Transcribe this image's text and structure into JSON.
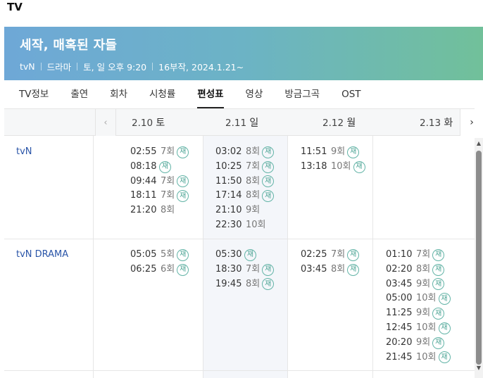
{
  "page": {
    "heading": "TV"
  },
  "program": {
    "title": "세작, 매혹된 자들",
    "meta": [
      "tvN",
      "드라마",
      "토, 일 오후 9:20",
      "16부작, 2024.1.21~"
    ]
  },
  "tabs": [
    {
      "label": "TV정보",
      "active": false
    },
    {
      "label": "출연",
      "active": false
    },
    {
      "label": "회차",
      "active": false
    },
    {
      "label": "시청률",
      "active": false
    },
    {
      "label": "편성표",
      "active": true
    },
    {
      "label": "영상",
      "active": false
    },
    {
      "label": "방금그곡",
      "active": false
    },
    {
      "label": "OST",
      "active": false
    }
  ],
  "schedule": {
    "prev_icon": "chevron-left-icon",
    "next_icon": "chevron-right-icon",
    "rerun_label": "재",
    "dates": [
      {
        "date": "2.10",
        "day": "토"
      },
      {
        "date": "2.11",
        "day": "일"
      },
      {
        "date": "2.12",
        "day": "월"
      },
      {
        "date": "2.13",
        "day": "화"
      }
    ],
    "channels": [
      {
        "name": "tvN",
        "days": [
          [
            {
              "time": "02:55",
              "ep": "7회",
              "rerun": true
            },
            {
              "time": "08:18",
              "ep": "",
              "rerun": true
            },
            {
              "time": "09:44",
              "ep": "7회",
              "rerun": true
            },
            {
              "time": "18:11",
              "ep": "7회",
              "rerun": true
            },
            {
              "time": "21:20",
              "ep": "8회",
              "rerun": false
            }
          ],
          [
            {
              "time": "03:02",
              "ep": "8회",
              "rerun": true
            },
            {
              "time": "10:25",
              "ep": "7회",
              "rerun": true
            },
            {
              "time": "11:50",
              "ep": "8회",
              "rerun": true
            },
            {
              "time": "17:14",
              "ep": "8회",
              "rerun": true
            },
            {
              "time": "21:10",
              "ep": "9회",
              "rerun": false
            },
            {
              "time": "22:30",
              "ep": "10회",
              "rerun": false
            }
          ],
          [
            {
              "time": "11:51",
              "ep": "9회",
              "rerun": true
            },
            {
              "time": "13:18",
              "ep": "10회",
              "rerun": true
            }
          ],
          []
        ]
      },
      {
        "name": "tvN DRAMA",
        "days": [
          [
            {
              "time": "05:05",
              "ep": "5회",
              "rerun": true
            },
            {
              "time": "06:25",
              "ep": "6회",
              "rerun": true
            }
          ],
          [
            {
              "time": "05:30",
              "ep": "",
              "rerun": true
            },
            {
              "time": "18:30",
              "ep": "7회",
              "rerun": true
            },
            {
              "time": "19:45",
              "ep": "8회",
              "rerun": true
            }
          ],
          [
            {
              "time": "02:25",
              "ep": "7회",
              "rerun": true
            },
            {
              "time": "03:45",
              "ep": "8회",
              "rerun": true
            }
          ],
          [
            {
              "time": "01:10",
              "ep": "7회",
              "rerun": true
            },
            {
              "time": "02:20",
              "ep": "8회",
              "rerun": true
            },
            {
              "time": "03:45",
              "ep": "9회",
              "rerun": true
            },
            {
              "time": "05:00",
              "ep": "10회",
              "rerun": true
            },
            {
              "time": "11:25",
              "ep": "9회",
              "rerun": true
            },
            {
              "time": "12:45",
              "ep": "10회",
              "rerun": true
            },
            {
              "time": "20:20",
              "ep": "9회",
              "rerun": true
            },
            {
              "time": "21:45",
              "ep": "10회",
              "rerun": true
            }
          ]
        ]
      }
    ]
  }
}
